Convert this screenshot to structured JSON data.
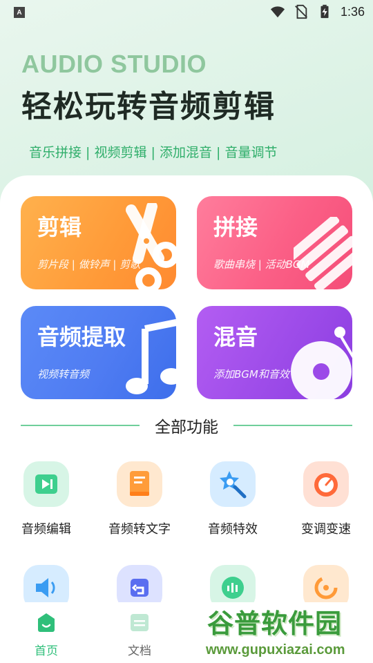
{
  "status_bar": {
    "left_icon": "A",
    "time": "1:36",
    "icons": [
      "wifi-icon",
      "no-sim-icon",
      "battery-charging-icon"
    ]
  },
  "header": {
    "brand": "AUDIO STUDIO",
    "headline": "轻松玩转音频剪辑",
    "tagline": "音乐拼接 | 视频剪辑 | 添加混音 | 音量调节"
  },
  "cards": [
    {
      "title": "剪辑",
      "subtitle": "剪片段 | 做铃声 | 剪歌",
      "icon": "scissors-icon",
      "color": "#ff9a38"
    },
    {
      "title": "拼接",
      "subtitle": "歌曲串烧 | 活动BGM",
      "icon": "stripes-icon",
      "color": "#fb5f86"
    },
    {
      "title": "音频提取",
      "subtitle": "视频转音频",
      "icon": "music-note-icon",
      "color": "#4f7cf2"
    },
    {
      "title": "混音",
      "subtitle": "添加BGM和音效",
      "icon": "disc-icon",
      "color": "#9b4ae8"
    }
  ],
  "section": {
    "title": "全部功能"
  },
  "features": [
    {
      "label": "音频编辑",
      "icon": "audio-edit-icon",
      "color": "#3ecf8e"
    },
    {
      "label": "音频转文字",
      "icon": "document-icon",
      "color": "#ff9c3a"
    },
    {
      "label": "音频特效",
      "icon": "magic-wand-icon",
      "color": "#3a9cf2"
    },
    {
      "label": "变调变速",
      "icon": "speedometer-icon",
      "color": "#ff6a3a"
    },
    {
      "label": "",
      "icon": "speaker-icon",
      "color": "#3a9cf2"
    },
    {
      "label": "",
      "icon": "undo-icon",
      "color": "#5a6ef0"
    },
    {
      "label": "",
      "icon": "waveform-icon",
      "color": "#3ecf8e"
    },
    {
      "label": "",
      "icon": "spinner-icon",
      "color": "#ff9a38"
    }
  ],
  "bottom_nav": [
    {
      "label": "首页",
      "icon": "home-icon",
      "active": true
    },
    {
      "label": "文档",
      "icon": "folder-icon",
      "active": false
    }
  ],
  "watermark": {
    "title": "谷普软件园",
    "url": "www.gupuxiazai.com"
  }
}
